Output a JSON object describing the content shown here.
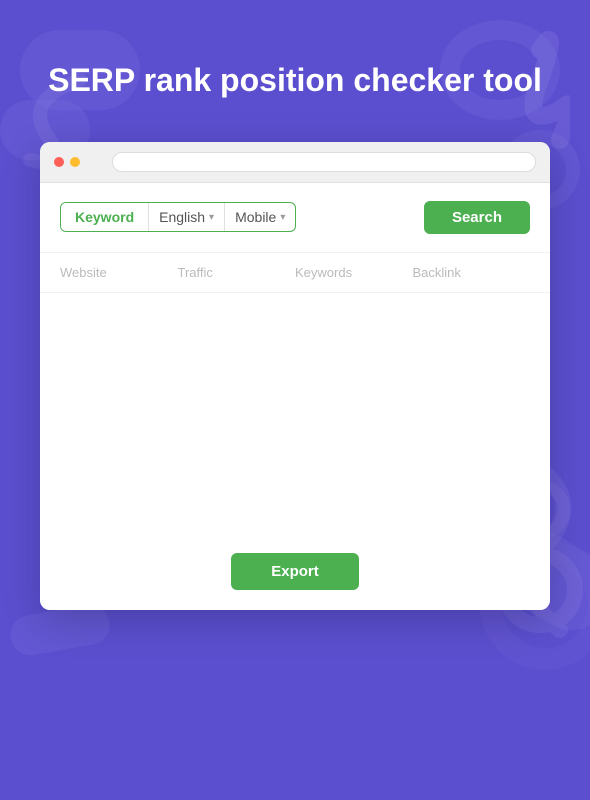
{
  "hero": {
    "title": "SERP rank position checker tool"
  },
  "toolbar": {
    "keyword_label": "Keyword",
    "language_label": "English",
    "device_label": "Mobile",
    "search_label": "Search"
  },
  "table": {
    "columns": [
      "Website",
      "Traffic",
      "Keywords",
      "Backlink"
    ]
  },
  "export_label": "Export",
  "browser": {
    "dots": [
      "red",
      "yellow",
      "green"
    ]
  },
  "colors": {
    "green": "#4caf50",
    "purple": "#5b4fcf"
  }
}
